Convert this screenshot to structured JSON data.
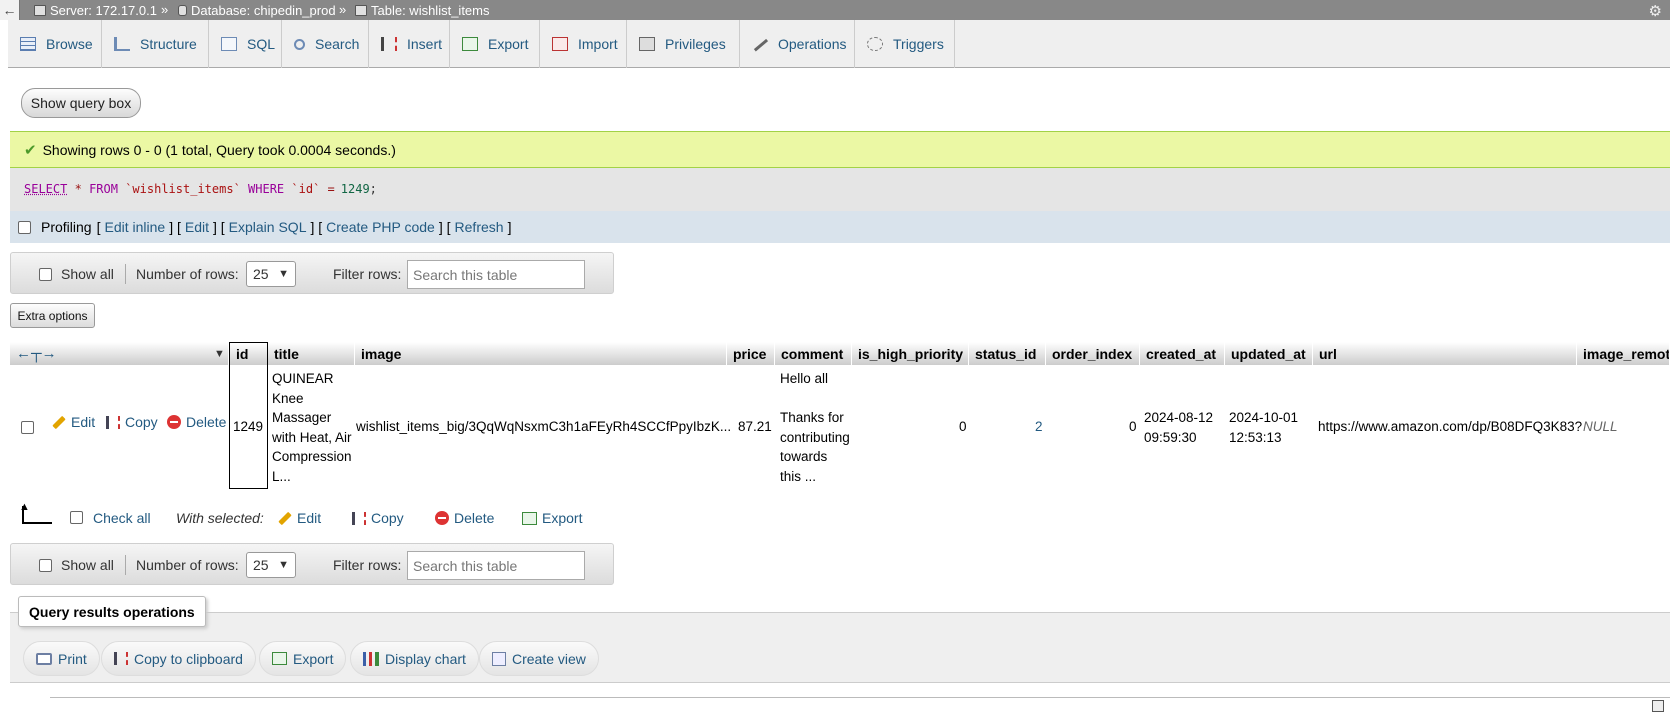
{
  "breadcrumb": {
    "server": "Server: 172.17.0.1",
    "database": "Database: chipedin_prod",
    "table": "Table: wishlist_items",
    "separator": "»"
  },
  "tabs": [
    "Browse",
    "Structure",
    "SQL",
    "Search",
    "Insert",
    "Export",
    "Import",
    "Privileges",
    "Operations",
    "Triggers"
  ],
  "show_query_box": "Show query box",
  "success_message": "Showing rows 0 - 0 (1 total, Query took 0.0004 seconds.)",
  "sql": {
    "select": "SELECT",
    "star": "*",
    "from": "FROM",
    "table": "`wishlist_items`",
    "where": "WHERE",
    "column": "`id`",
    "op": "=",
    "value": "1249",
    "end": ";"
  },
  "profiling": {
    "label": "Profiling",
    "edit_inline": "Edit inline",
    "edit": "Edit",
    "explain": "Explain SQL",
    "php": "Create PHP code",
    "refresh": "Refresh",
    "lb": "[",
    "rb": "]",
    "mid": "] ["
  },
  "nav": {
    "show_all": "Show all",
    "rows_label": "Number of rows:",
    "rows_value": "25",
    "filter_label": "Filter rows:",
    "filter_placeholder": "Search this table"
  },
  "extra_options": "Extra options",
  "table": {
    "columns": [
      "id",
      "title",
      "image",
      "price",
      "comment",
      "is_high_priority",
      "status_id",
      "order_index",
      "created_at",
      "updated_at",
      "url",
      "image_remote"
    ],
    "row": {
      "edit": "Edit",
      "copy": "Copy",
      "delete": "Delete",
      "id": "1249",
      "title_lines": [
        "QUINEAR",
        "Knee",
        "Massager",
        "with Heat, Air",
        "Compression",
        "L..."
      ],
      "image": "wishlist_items_big/3QqWqNsxmC3h1aFEyRh4SCCfPpyIbzK...",
      "price": "87.21",
      "comment_lines": [
        "Hello all",
        "",
        "Thanks for",
        "contributing",
        "towards",
        "this ..."
      ],
      "is_high_priority": "0",
      "status_id": "2",
      "order_index": "0",
      "created_at": [
        "2024-08-12",
        "09:59:30"
      ],
      "updated_at": [
        "2024-10-01",
        "12:53:13"
      ],
      "url": "https://www.amazon.com/dp/B08DFQ3K83?",
      "image_remote": "NULL"
    }
  },
  "bulk": {
    "check_all": "Check all",
    "with_selected": "With selected:",
    "edit": "Edit",
    "copy": "Copy",
    "delete": "Delete",
    "export": "Export"
  },
  "query_ops": {
    "legend": "Query results operations",
    "print": "Print",
    "copy": "Copy to clipboard",
    "export": "Export",
    "chart": "Display chart",
    "view": "Create view"
  },
  "colors": {
    "link": "#235a81",
    "success_bg": "#ebf8a4",
    "topbar": "#888888"
  }
}
